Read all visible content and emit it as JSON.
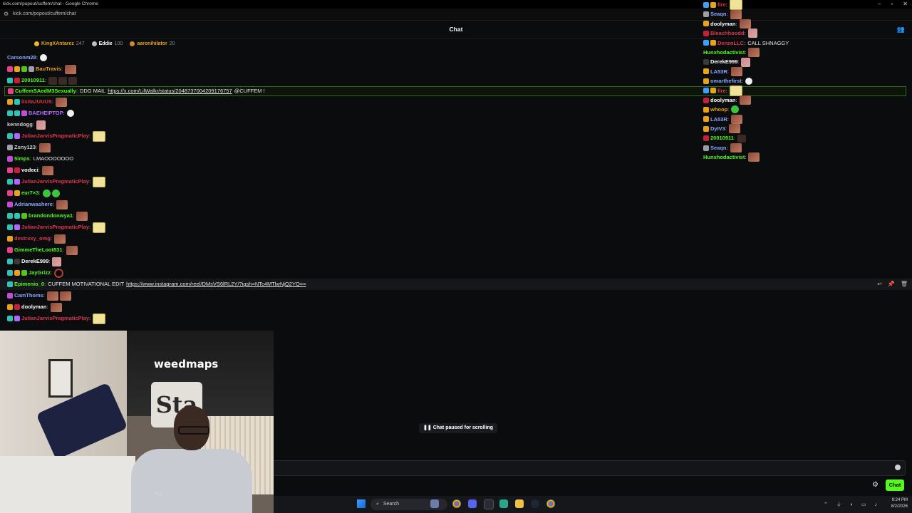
{
  "window": {
    "title": "kick.com/popout/cuffem/chat - Google Chrome",
    "url": "kick.com/popout/cuffem/chat"
  },
  "chat": {
    "title": "Chat",
    "paused_text": "Chat paused for scrolling",
    "send_label": "Chat"
  },
  "leaderboard": [
    {
      "name": "KingXAntarez",
      "count": "247",
      "color": "#e8a317",
      "coin": "#f0b429"
    },
    {
      "name": "Eddie",
      "count": "100",
      "color": "#ffffff",
      "coin": "#c0c0c0"
    },
    {
      "name": "aaronihilator",
      "count": "20",
      "color": "#e8a317",
      "coin": "#d08a3c"
    }
  ],
  "messages": [
    {
      "user": "Carsonm28",
      "color": "#8aa6ff",
      "badges": [],
      "text": "",
      "emotes": [
        "ghost"
      ]
    },
    {
      "user": "BauTravis",
      "color": "#e8a317",
      "badges": [
        "#e8408a",
        "#e8a317",
        "#53c41a",
        "#9aa0a6"
      ],
      "text": "",
      "emotes": [
        "meme"
      ]
    },
    {
      "user": "20010911",
      "color": "#53fc18",
      "badges": [
        "#2ec4b6",
        "#c81e3a"
      ],
      "text": "",
      "emotes": [
        "dark",
        "dark",
        "dark"
      ]
    },
    {
      "user": "CuffemSAedM3Sexually",
      "color": "#53fc18",
      "badges": [
        "#e8408a"
      ],
      "text": "DDG MAIL",
      "link": "https://x.com/LilWalkr/status/2048737004209176757",
      "after": "@CUFFEM !",
      "highlight": true
    },
    {
      "user": "itsitaJUUUS",
      "color": "#e0354a",
      "badges": [
        "#e8a317",
        "#2ec4b6"
      ],
      "text": "",
      "emotes": [
        "meme"
      ]
    },
    {
      "user": "BAEHEIPTOP",
      "color": "#b066ff",
      "badges": [
        "#2ec4b6",
        "#2ec4b6",
        "#c64bd6"
      ],
      "text": "",
      "emotes": [
        "ghost"
      ]
    },
    {
      "user": "kenndogg",
      "color": "#cfcfcf",
      "badges": [],
      "text": "",
      "emotes": [
        "pink"
      ]
    },
    {
      "user": "JulianJarvisPragmaticPlay",
      "color": "#e0354a",
      "badges": [
        "#2ec4b6",
        "#b066ff"
      ],
      "text": "",
      "emotes": [
        "cookie"
      ]
    },
    {
      "user": "Zsny123",
      "color": "#cfcfcf",
      "badges": [
        "#9aa0a6"
      ],
      "text": "",
      "emotes": [
        "meme"
      ]
    },
    {
      "user": "5imps",
      "color": "#53fc18",
      "badges": [
        "#c64bd6"
      ],
      "text": "LMAOOOOOOO",
      "emotes": []
    },
    {
      "user": "vodeci",
      "color": "#ffffff",
      "badges": [
        "#e8408a",
        "#c81e3a"
      ],
      "text": "",
      "emotes": [
        "meme"
      ]
    },
    {
      "user": "JulianJarvisPragmaticPlay",
      "color": "#e0354a",
      "badges": [
        "#2ec4b6",
        "#b066ff"
      ],
      "text": "",
      "emotes": [
        "cookie"
      ]
    },
    {
      "user": "eur7×3",
      "color": "#53fc18",
      "badges": [
        "#e8408a",
        "#e8a317"
      ],
      "text": "",
      "emotes": [
        "green",
        "green"
      ]
    },
    {
      "user": "Adrianwashere",
      "color": "#8aa6ff",
      "badges": [
        "#c64bd6"
      ],
      "text": "",
      "emotes": [
        "meme"
      ]
    },
    {
      "user": "brandondonwya1",
      "color": "#53fc18",
      "badges": [
        "#2ec4b6",
        "#2ec4b6",
        "#53c41a"
      ],
      "text": "",
      "emotes": [
        "meme"
      ]
    },
    {
      "user": "JulianJarvisPragmaticPlay",
      "color": "#e0354a",
      "badges": [
        "#2ec4b6",
        "#b066ff"
      ],
      "text": "",
      "emotes": [
        "cookie"
      ]
    },
    {
      "user": "destrxxy_omg",
      "color": "#e0354a",
      "badges": [
        "#e8a317"
      ],
      "text": "",
      "emotes": [
        "meme"
      ]
    },
    {
      "user": "GimmeTheLoot831",
      "color": "#53fc18",
      "badges": [
        "#e8408a"
      ],
      "text": "",
      "emotes": [
        "meme"
      ]
    },
    {
      "user": "DerekE999",
      "color": "#ffffff",
      "badges": [
        "#2ec4b6",
        "#3a3a3a"
      ],
      "text": "",
      "emotes": [
        "pink"
      ]
    },
    {
      "user": "JayGrizz",
      "color": "#53fc18",
      "badges": [
        "#2ec4b6",
        "#e8a317",
        "#53c41a"
      ],
      "text": "",
      "emotes": [
        "ring"
      ]
    },
    {
      "user": "Epimenio_0",
      "color": "#53fc18",
      "badges": [
        "#2ec4b6"
      ],
      "text": "CUFFEM MOTIVATIONAL EDIT",
      "link": "https://www.instagram.com/reel/DMsVS6lRL2Y/?igsh=NTc4MTlwNjQ2YQ==",
      "after": "",
      "hover": true
    },
    {
      "user": "CamThoms",
      "color": "#8aa6ff",
      "badges": [
        "#c64bd6"
      ],
      "text": "",
      "emotes": [
        "meme",
        "meme"
      ]
    },
    {
      "user": "doolyman",
      "color": "#ffffff",
      "badges": [
        "#e8a317",
        "#c81e3a"
      ],
      "text": "",
      "emotes": [
        "meme"
      ]
    },
    {
      "user": "JulianJarvisPragmaticPlay",
      "color": "#e0354a",
      "badges": [
        "#2ec4b6",
        "#b066ff"
      ],
      "text": "",
      "emotes": [
        "cookie"
      ]
    }
  ],
  "right_messages": [
    {
      "user": "fire",
      "color": "#e0354a",
      "badges": [
        "#3aa0ff",
        "#e8a317"
      ],
      "text": "",
      "emotes": [
        "cookie"
      ]
    },
    {
      "user": "Seaqn",
      "color": "#8aa6ff",
      "badges": [
        "#9aa0a6"
      ],
      "text": "",
      "emotes": [
        "meme"
      ]
    },
    {
      "user": "doolyman",
      "color": "#ffffff",
      "badges": [
        "#e8a317"
      ],
      "text": "",
      "emotes": [
        "meme"
      ]
    },
    {
      "user": "Bleachhoodd",
      "color": "#e0354a",
      "badges": [
        "#c81e3a"
      ],
      "text": "",
      "emotes": [
        "pink"
      ]
    },
    {
      "user": "DenzoLLC",
      "color": "#e0354a",
      "badges": [
        "#3aa0ff",
        "#e8a317"
      ],
      "text": "CALL SHNAGGY",
      "emotes": []
    },
    {
      "user": "Hunxhodactivist",
      "color": "#53fc18",
      "badges": [],
      "text": "",
      "emotes": [
        "meme"
      ]
    },
    {
      "user": "DerekE999",
      "color": "#ffffff",
      "badges": [
        "#3a3a3a"
      ],
      "text": "",
      "emotes": [
        "pink"
      ]
    },
    {
      "user": "LA53R",
      "color": "#8aa6ff",
      "badges": [
        "#e8a317"
      ],
      "text": "",
      "emotes": [
        "meme"
      ]
    },
    {
      "user": "omarthefirst",
      "color": "#8aa6ff",
      "badges": [
        "#e8a317"
      ],
      "text": "",
      "emotes": [
        "ghost"
      ]
    },
    {
      "user": "fire",
      "color": "#e0354a",
      "badges": [
        "#3aa0ff",
        "#e8a317"
      ],
      "text": "",
      "emotes": [
        "cookie"
      ]
    },
    {
      "user": "doolyman",
      "color": "#ffffff",
      "badges": [
        "#c81e3a"
      ],
      "text": "",
      "emotes": [
        "meme"
      ]
    },
    {
      "user": "whoop",
      "color": "#e8a317",
      "badges": [
        "#e8a317"
      ],
      "text": "",
      "emotes": [
        "green"
      ]
    },
    {
      "user": "LA53R",
      "color": "#8aa6ff",
      "badges": [
        "#e8a317"
      ],
      "text": "",
      "emotes": [
        "meme"
      ]
    },
    {
      "user": "DyIV3",
      "color": "#8aa6ff",
      "badges": [
        "#e8a317"
      ],
      "text": "",
      "emotes": [
        "meme"
      ]
    },
    {
      "user": "20010911",
      "color": "#53fc18",
      "badges": [
        "#c81e3a"
      ],
      "text": "",
      "emotes": [
        "dark"
      ]
    },
    {
      "user": "Seaqn",
      "color": "#8aa6ff",
      "badges": [
        "#9aa0a6"
      ],
      "text": "",
      "emotes": [
        "meme"
      ]
    },
    {
      "user": "Hunxhodactivist",
      "color": "#53fc18",
      "badges": [],
      "text": "",
      "emotes": [
        "meme"
      ]
    }
  ],
  "video": {
    "banner_text": "weedmaps",
    "sign_text": "Sta",
    "shirt_text": "Ku"
  },
  "taskbar": {
    "search_placeholder": "Search",
    "time": "9:24 PM",
    "date": "8/2/2026"
  },
  "colors": {
    "accent": "#53fc18",
    "background": "#0b0c0e"
  }
}
